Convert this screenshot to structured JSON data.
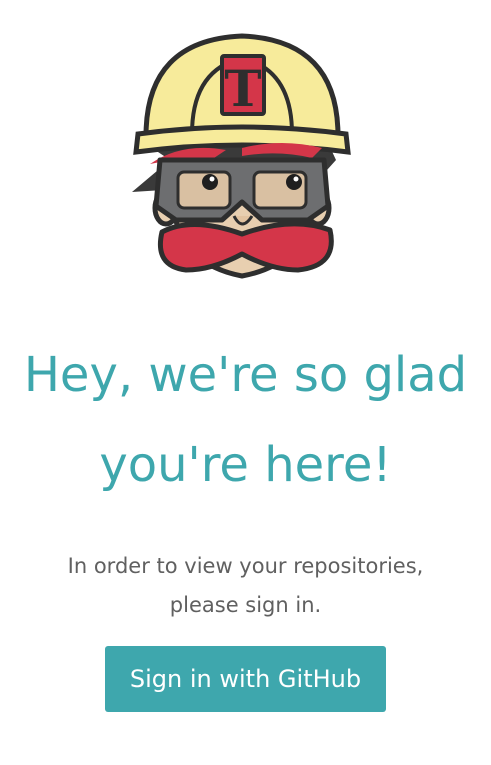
{
  "mascot": {
    "name": "travis-ci-mascot-icon",
    "badge_letter": "T"
  },
  "headline": {
    "line1": "Hey, we're so glad",
    "line2": "you're here!"
  },
  "message": {
    "line1": "In order to view your repositories,",
    "line2": "please sign in."
  },
  "signin_button": {
    "label": "Sign in with GitHub"
  },
  "colors": {
    "accent": "#3ea7ad",
    "text": "#606060",
    "button_text": "#ffffff",
    "helmet": "#f7eb9b",
    "mustache": "#d43649",
    "goggles": "#6d6e70",
    "skin": "#e8cfb0"
  }
}
